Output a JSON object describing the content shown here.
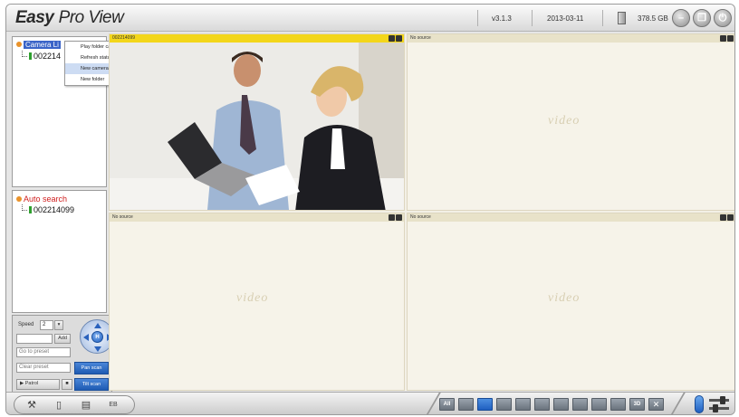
{
  "app": {
    "logo_bold": "Easy",
    "logo_rest": "Pro View",
    "version": "v3.1.3",
    "date": "2013-03-11",
    "disk_free": "378.5 GB"
  },
  "camera_tree": {
    "root_label": "Camera Li",
    "child_label": "002214"
  },
  "context_menu": {
    "items": [
      "Play folder cameras",
      "Refresh status",
      "New camera",
      "New folder"
    ],
    "highlighted_index": 2
  },
  "auto_search": {
    "root_label": "Auto search",
    "child_label": "002214099"
  },
  "ptz": {
    "speed_label": "Speed",
    "speed_value": "2",
    "add_label": "Add",
    "goto_preset": "Go to preset",
    "clear_preset": "Clear preset",
    "patrol_label": "Patrol",
    "pan_scan": "Pan scan",
    "tilt_scan": "Tilt scan",
    "joystick_center": "H"
  },
  "video": {
    "cells": [
      {
        "header": "002214099",
        "active": true
      },
      {
        "header": "No source",
        "active": false,
        "watermark": "video"
      },
      {
        "header": "No source",
        "active": false,
        "watermark": "video"
      },
      {
        "header": "No source",
        "active": false,
        "watermark": "video"
      }
    ]
  },
  "bottombar": {
    "layout_all": "All",
    "layout_3d": "3D"
  },
  "colors": {
    "selection_blue": "#3a64c8",
    "active_header": "#f3d61a",
    "auto_search_red": "#d02020",
    "camera_green": "#2e9f2e"
  }
}
